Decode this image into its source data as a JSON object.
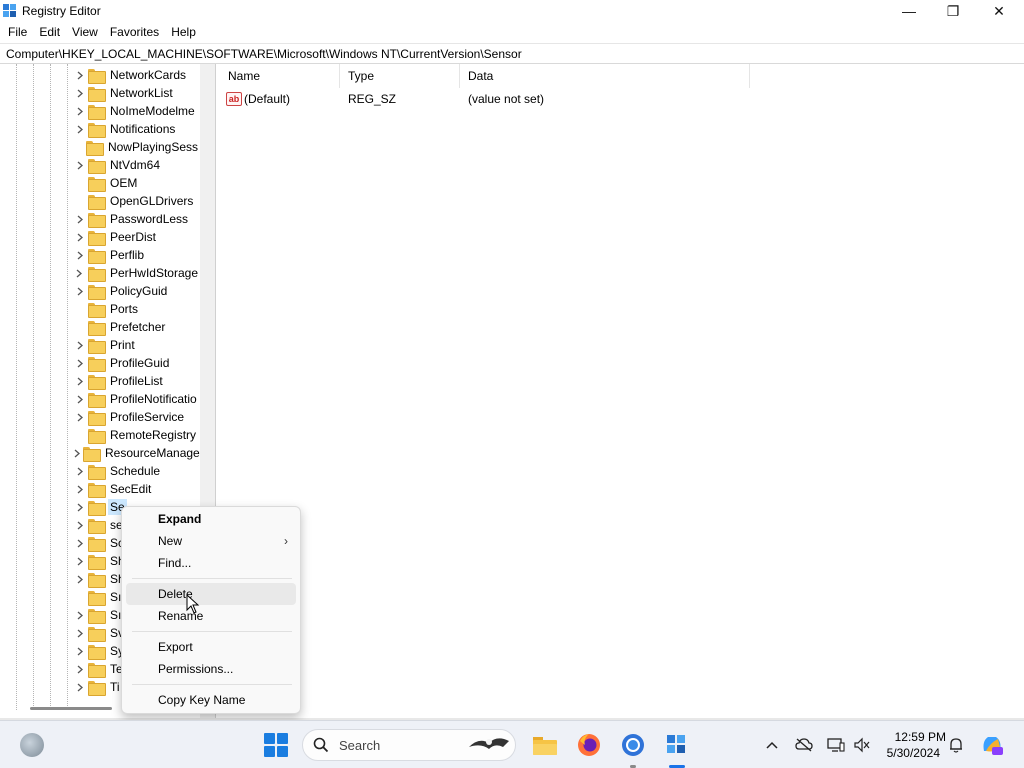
{
  "window": {
    "title": "Registry Editor",
    "minimize_glyph": "—",
    "restore_glyph": "❐",
    "close_glyph": "✕"
  },
  "menu": [
    "File",
    "Edit",
    "View",
    "Favorites",
    "Help"
  ],
  "address": "Computer\\HKEY_LOCAL_MACHINE\\SOFTWARE\\Microsoft\\Windows NT\\CurrentVersion\\Sensor",
  "tree": {
    "items": [
      {
        "label": "NetworkCards",
        "expandable": true
      },
      {
        "label": "NetworkList",
        "expandable": true
      },
      {
        "label": "NoImeModelme",
        "expandable": true
      },
      {
        "label": "Notifications",
        "expandable": true
      },
      {
        "label": "NowPlayingSess",
        "expandable": false
      },
      {
        "label": "NtVdm64",
        "expandable": true
      },
      {
        "label": "OEM",
        "expandable": false
      },
      {
        "label": "OpenGLDrivers",
        "expandable": false
      },
      {
        "label": "PasswordLess",
        "expandable": true
      },
      {
        "label": "PeerDist",
        "expandable": true
      },
      {
        "label": "Perflib",
        "expandable": true
      },
      {
        "label": "PerHwIdStorage",
        "expandable": true
      },
      {
        "label": "PolicyGuid",
        "expandable": true
      },
      {
        "label": "Ports",
        "expandable": false
      },
      {
        "label": "Prefetcher",
        "expandable": false
      },
      {
        "label": "Print",
        "expandable": true
      },
      {
        "label": "ProfileGuid",
        "expandable": true
      },
      {
        "label": "ProfileList",
        "expandable": true
      },
      {
        "label": "ProfileNotificatio",
        "expandable": true
      },
      {
        "label": "ProfileService",
        "expandable": true
      },
      {
        "label": "RemoteRegistry",
        "expandable": false
      },
      {
        "label": "ResourceManage",
        "expandable": true
      },
      {
        "label": "Schedule",
        "expandable": true
      },
      {
        "label": "SecEdit",
        "expandable": true
      },
      {
        "label": "Se",
        "expandable": true,
        "selected": true
      },
      {
        "label": "se",
        "expandable": true
      },
      {
        "label": "Sc",
        "expandable": true
      },
      {
        "label": "Sh",
        "expandable": true
      },
      {
        "label": "Sh",
        "expandable": true
      },
      {
        "label": "Sı",
        "expandable": false
      },
      {
        "label": "Sı",
        "expandable": true
      },
      {
        "label": "Sv",
        "expandable": true
      },
      {
        "label": "Sy",
        "expandable": true
      },
      {
        "label": "Te",
        "expandable": true
      },
      {
        "label": "Ti",
        "expandable": true
      }
    ]
  },
  "list": {
    "columns": [
      "Name",
      "Type",
      "Data"
    ],
    "rows": [
      {
        "icon": "string-value-icon",
        "icon_text": "ab",
        "name": "(Default)",
        "type": "REG_SZ",
        "data": "(value not set)"
      }
    ]
  },
  "context_menu": {
    "items": [
      {
        "label": "Expand",
        "bold": true
      },
      {
        "label": "New",
        "submenu": true
      },
      {
        "label": "Find..."
      },
      {
        "label": "Delete",
        "hover": true
      },
      {
        "label": "Rename"
      },
      {
        "label": "Export"
      },
      {
        "label": "Permissions..."
      },
      {
        "label": "Copy Key Name"
      }
    ],
    "submenu_glyph": "›"
  },
  "taskbar": {
    "search_placeholder": "Search",
    "apps": [
      "file-explorer-icon",
      "firefox-icon",
      "chrome-icon",
      "registry-editor-icon"
    ],
    "tray": {
      "chevron": "^",
      "time": "12:59 PM",
      "date": "5/30/2024"
    }
  }
}
